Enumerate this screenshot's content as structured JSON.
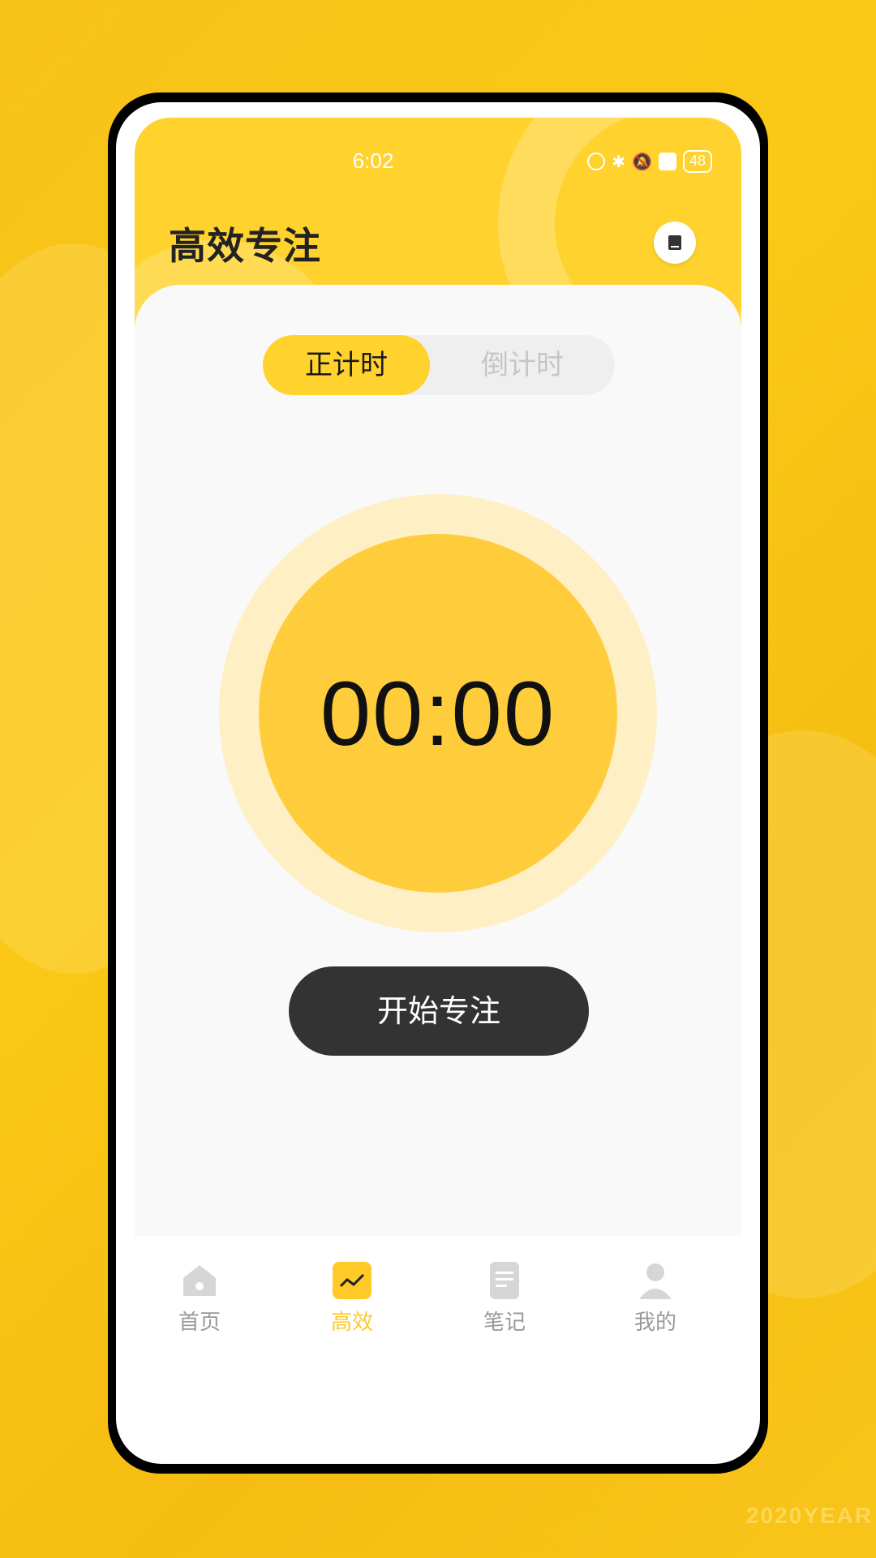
{
  "status": {
    "time": "6:02",
    "battery": "48"
  },
  "header": {
    "title": "高效专注"
  },
  "toggle": {
    "count_up": "正计时",
    "countdown": "倒计时"
  },
  "timer": {
    "display": "00:00"
  },
  "start_button": {
    "label": "开始专注"
  },
  "tabbar": {
    "items": [
      {
        "label": "首页",
        "icon": "home-icon",
        "active": false
      },
      {
        "label": "高效",
        "icon": "chart-icon",
        "active": true
      },
      {
        "label": "笔记",
        "icon": "note-icon",
        "active": false
      },
      {
        "label": "我的",
        "icon": "profile-icon",
        "active": false
      }
    ]
  },
  "watermark": "2020YEAR",
  "colors": {
    "accent": "#ffd22e",
    "dark_button": "#333333",
    "ring": "#ffefc4",
    "inner": "#ffcd3c"
  }
}
